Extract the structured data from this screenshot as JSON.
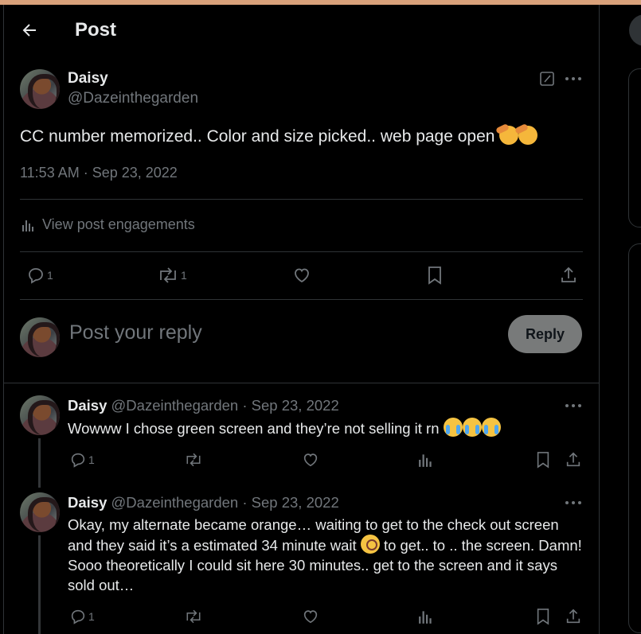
{
  "header": {
    "title": "Post"
  },
  "post": {
    "author": "Daisy",
    "handle": "@Dazeinthegarden",
    "text": "CC number memorized.. Color and size picked.. web page open",
    "timestamp": "11:53 AM · Sep 23, 2022",
    "engagements_label": "View post engagements",
    "reply_count": "1",
    "repost_count": "1"
  },
  "composer": {
    "placeholder": "Post your reply",
    "button": "Reply"
  },
  "replies": [
    {
      "author": "Daisy",
      "handle": "@Dazeinthegarden",
      "date": "· Sep 23, 2022",
      "text": "Wowww I chose green screen and they’re not selling it rn",
      "reply_count": "1"
    },
    {
      "author": "Daisy",
      "handle": "@Dazeinthegarden",
      "date": "· Sep 23, 2022",
      "text_a": "Okay, my alternate became orange… waiting to get to the check out screen and they said it’s a estimated 34 minute wait",
      "text_b": "to get.. to .. the screen. Damn! Sooo theoretically I could sit here 30 minutes.. get to the screen and it says sold out…",
      "reply_count": "1"
    }
  ],
  "icons": [
    "back-arrow-icon",
    "grok-icon",
    "more-icon",
    "engagements-icon",
    "reply-icon",
    "repost-icon",
    "like-icon",
    "bookmark-icon",
    "share-icon",
    "views-icon"
  ],
  "colors": {
    "background": "#000000",
    "text": "#e7e9ea",
    "muted": "#71767b",
    "divider": "#2f3336",
    "reply_button": "#787a7a"
  }
}
